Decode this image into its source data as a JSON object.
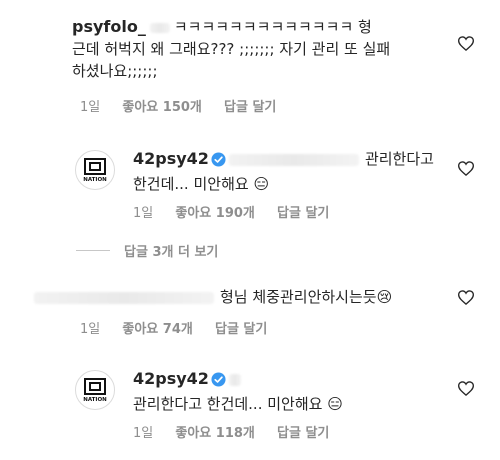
{
  "comments": [
    {
      "username": "psyfolo_",
      "text_line1": "ㅋㅋㅋㅋㅋㅋㅋㅋㅋㅋㅋㅋㅋ 형",
      "text_line2": "근데 허벅지 왜 그래요??? ;;;;;;; 자기 관리 또 실패",
      "text_line3": "하셨나요;;;;;;",
      "time": "1일",
      "likes": "좋아요 150개",
      "reply": "답글 달기"
    },
    {
      "username": "42psy42",
      "text_line1": "관리한다고",
      "text_line2": "한건데... 미안해요 😑",
      "time": "1일",
      "likes": "좋아요 190개",
      "reply": "답글 달기",
      "avatar_label": "NATION"
    },
    {
      "username": "",
      "text_line1": "형님 체중관리안하시는듯😢",
      "time": "1일",
      "likes": "좋아요 74개",
      "reply": "답글 달기"
    },
    {
      "username": "42psy42",
      "text_line1": "관리한다고 한건데... 미안해요 😑",
      "time": "1일",
      "likes": "좋아요 118개",
      "reply": "답글 달기",
      "avatar_label": "NATION"
    }
  ],
  "view_replies": "답글 3개 더 보기",
  "icons": {
    "heart": "heart-outline-icon",
    "verified": "verified-badge-icon"
  },
  "colors": {
    "meta_gray": "#8e8e8e",
    "verified_blue": "#3897f0"
  }
}
